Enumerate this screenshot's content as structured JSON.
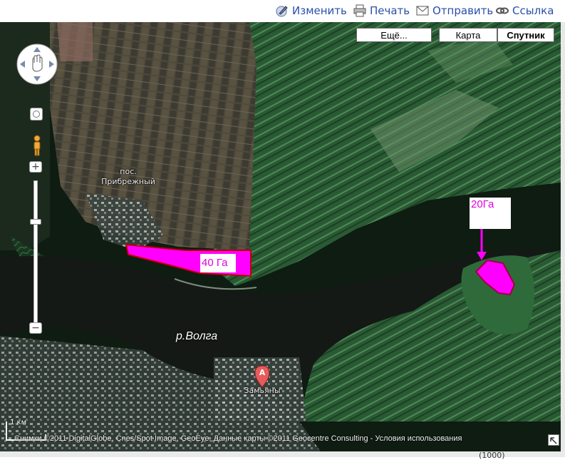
{
  "toolbar": {
    "items": [
      {
        "label": "Изменить",
        "icon": "edit-icon"
      },
      {
        "label": "Печать",
        "icon": "print-icon"
      },
      {
        "label": "Отправить",
        "icon": "email-icon"
      },
      {
        "label": "Ссылка",
        "icon": "link-icon"
      }
    ]
  },
  "map_types": {
    "more": "Ещё...",
    "map": "Карта",
    "satellite": "Спутник",
    "active": "satellite"
  },
  "zoom": {
    "plus": "+",
    "minus": "−"
  },
  "places": {
    "settlement": "пос.\nПрибрежный",
    "marker_letter": "A",
    "marker_label": "Замьяны",
    "river": "р.Волга"
  },
  "annotations": {
    "area_40": "40 Га",
    "area_20": "20Га",
    "highlight_color": "#ff00ff"
  },
  "scale": {
    "label": "1 км"
  },
  "copyright": "Снимки ©2011 DigitalGlobe, Cnes/Spot Image, GeoEye, Данные карты ©2011 Geocentre Consulting - Условия использования",
  "bottom_text": "(1000)",
  "colors": {
    "river": "#151a17",
    "farmland": "#2e5a35",
    "settlement_land": "#5d5a4c",
    "toolbar_link": "#2a4fa8"
  }
}
